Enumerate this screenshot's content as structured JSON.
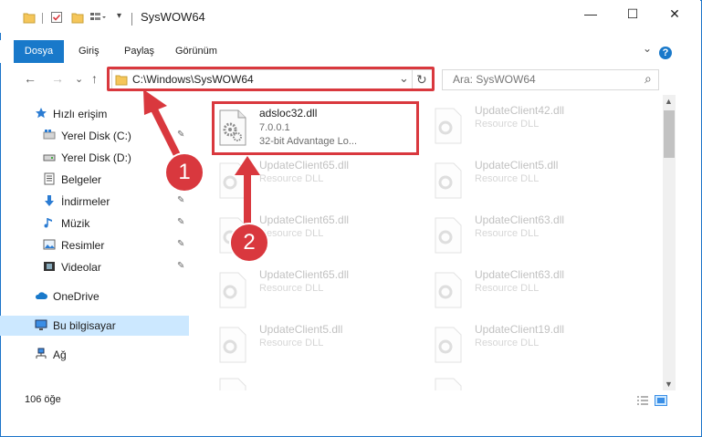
{
  "window": {
    "title": "SysWOW64",
    "minimize_glyph": "—",
    "maximize_glyph": "☐",
    "close_glyph": "✕"
  },
  "ribbon": {
    "tabs": [
      "Dosya",
      "Giriş",
      "Paylaş",
      "Görünüm"
    ],
    "expand_glyph": "⌄",
    "help_glyph": "?"
  },
  "navigation": {
    "back_glyph": "←",
    "forward_glyph": "→",
    "recent_glyph": "⌄",
    "up_glyph": "↑"
  },
  "address_bar": {
    "path": "C:\\Windows\\SysWOW64",
    "dropdown_glyph": "⌄",
    "refresh_glyph": "↻"
  },
  "search": {
    "placeholder": "Ara: SysWOW64",
    "icon_glyph": "⌕"
  },
  "sidebar": {
    "items": [
      {
        "label": "Hızlı erişim",
        "icon": "star-icon",
        "pinned": false
      },
      {
        "label": "Yerel Disk (C:)",
        "icon": "drive-icon",
        "pinned": true
      },
      {
        "label": "Yerel Disk (D:)",
        "icon": "drive-icon",
        "pinned": false
      },
      {
        "label": "Belgeler",
        "icon": "documents-icon",
        "pinned": true
      },
      {
        "label": "İndirmeler",
        "icon": "download-icon",
        "pinned": true
      },
      {
        "label": "Müzik",
        "icon": "music-icon",
        "pinned": true
      },
      {
        "label": "Resimler",
        "icon": "pictures-icon",
        "pinned": true
      },
      {
        "label": "Videolar",
        "icon": "videos-icon",
        "pinned": true
      },
      {
        "label": "OneDrive",
        "icon": "cloud-icon",
        "pinned": false
      },
      {
        "label": "Bu bilgisayar",
        "icon": "computer-icon",
        "pinned": false,
        "selected": true
      },
      {
        "label": "Ağ",
        "icon": "network-icon",
        "pinned": false
      }
    ],
    "pin_glyph": "📌"
  },
  "files": {
    "highlighted": {
      "name": "adsloc32.dll",
      "version": "7.0.0.1",
      "description": "32-bit Advantage Lo..."
    },
    "background": [
      {
        "name": "UpdateClient42.dll",
        "type": "Resource DLL"
      },
      {
        "name": "UpdateClient65.dll",
        "type": "Resource DLL"
      },
      {
        "name": "UpdateClient5.dll",
        "type": "Resource DLL"
      },
      {
        "name": "UpdateClient65.dll",
        "type": "Resource DLL"
      },
      {
        "name": "UpdateClient63.dll",
        "type": "Resource DLL"
      },
      {
        "name": "UpdateClient65.dll",
        "type": "Resource DLL"
      },
      {
        "name": "UpdateClient63.dll",
        "type": "Resource DLL"
      },
      {
        "name": "UpdateClient5.dll",
        "type": "Resource DLL"
      },
      {
        "name": "UpdateClient19.dll",
        "type": "Resource DLL"
      },
      {
        "name": "",
        "type": ""
      },
      {
        "name": "",
        "type": ""
      }
    ]
  },
  "status": {
    "item_count": "106 öğe"
  },
  "annotations": {
    "step1": "1",
    "step2": "2",
    "color": "#d9383e"
  }
}
